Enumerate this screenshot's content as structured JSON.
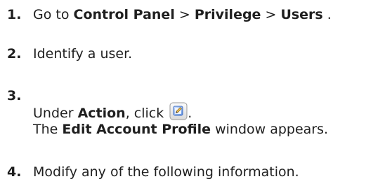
{
  "steps": [
    {
      "number": "1.",
      "parts": {
        "prefix": "Go to ",
        "control_panel": "Control Panel",
        "sep1": " > ",
        "privilege": "Privilege",
        "sep2": " > ",
        "users": "Users",
        "suffix": " ."
      }
    },
    {
      "number": "2.",
      "text": "Identify a user."
    },
    {
      "number": "3.",
      "line1": {
        "prefix": "Under ",
        "action": "Action",
        "mid": ", click ",
        "icon": "edit-icon",
        "suffix": "."
      },
      "line2": {
        "prefix": "The ",
        "window_name": "Edit Account Profile",
        "suffix": " window appears."
      }
    },
    {
      "number": "4.",
      "text": "Modify any of the following information."
    }
  ],
  "colors": {
    "text": "#1f1f1f",
    "icon_blue": "#4a7fd4",
    "icon_frame": "#9a9a9a"
  }
}
